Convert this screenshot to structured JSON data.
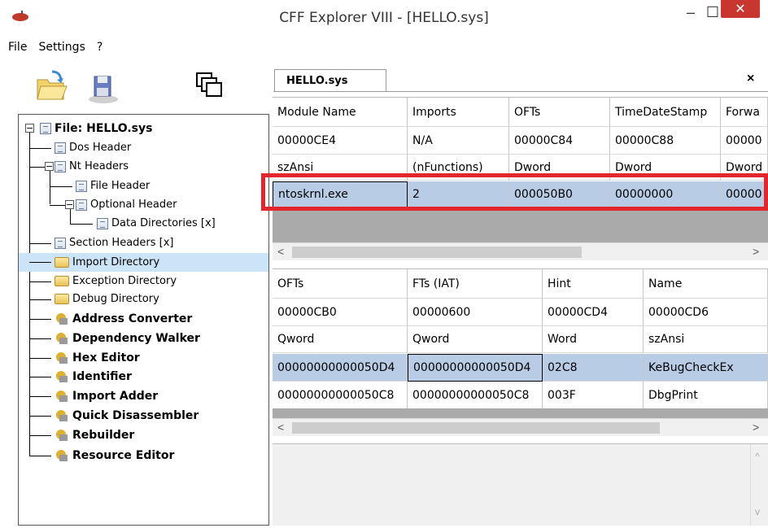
{
  "window": {
    "title": "CFF Explorer VIII - [HELLO.sys]",
    "min_symbol": "–",
    "max_symbol": "☐",
    "close_symbol": "✕"
  },
  "menu": [
    "File",
    "Settings",
    "?"
  ],
  "tree": {
    "root_label": "File: HELLO.sys",
    "items": [
      {
        "label": "Dos Header",
        "icon": "doc-icon"
      },
      {
        "label": "Nt Headers",
        "icon": "doc-icon"
      },
      {
        "label": "File Header",
        "icon": "doc-icon"
      },
      {
        "label": "Optional Header",
        "icon": "doc-icon"
      },
      {
        "label": "Data Directories [x]",
        "icon": "doc-icon"
      },
      {
        "label": "Section Headers [x]",
        "icon": "doc-icon"
      },
      {
        "label": "Import Directory",
        "icon": "folder-icon"
      },
      {
        "label": "Exception Directory",
        "icon": "folder-icon"
      },
      {
        "label": "Debug Directory",
        "icon": "folder-icon"
      },
      {
        "label": "Address Converter",
        "icon": "tool-icon"
      },
      {
        "label": "Dependency Walker",
        "icon": "tool-icon"
      },
      {
        "label": "Hex Editor",
        "icon": "tool-icon"
      },
      {
        "label": "Identifier",
        "icon": "tool-icon"
      },
      {
        "label": "Import Adder",
        "icon": "tool-icon"
      },
      {
        "label": "Quick Disassembler",
        "icon": "tool-icon"
      },
      {
        "label": "Rebuilder",
        "icon": "tool-icon"
      },
      {
        "label": "Resource Editor",
        "icon": "tool-icon"
      }
    ]
  },
  "tab": {
    "label": "HELLO.sys",
    "close": "×"
  },
  "modules_table": {
    "headers": [
      "Module Name",
      "Imports",
      "OFTs",
      "TimeDateStamp",
      "Forwa"
    ],
    "rows": [
      [
        "00000CE4",
        "N/A",
        "00000C84",
        "00000C88",
        "00000"
      ],
      [
        "szAnsi",
        "(nFunctions)",
        "Dword",
        "Dword",
        "Dword"
      ],
      [
        "ntoskrnl.exe",
        "2",
        "000050B0",
        "00000000",
        "00000"
      ]
    ]
  },
  "functions_table": {
    "headers": [
      "OFTs",
      "FTs (IAT)",
      "Hint",
      "Name"
    ],
    "rows": [
      [
        "00000CB0",
        "00000600",
        "00000CD4",
        "00000CD6"
      ],
      [
        "Qword",
        "Qword",
        "Word",
        "szAnsi"
      ],
      [
        "00000000000050D4",
        "00000000000050D4",
        "02C8",
        "KeBugCheckEx"
      ],
      [
        "00000000000050C8",
        "00000000000050C8",
        "003F",
        "DbgPrint"
      ]
    ]
  },
  "scroll": {
    "left": "<",
    "right": ">",
    "up": "^",
    "down": "v"
  }
}
